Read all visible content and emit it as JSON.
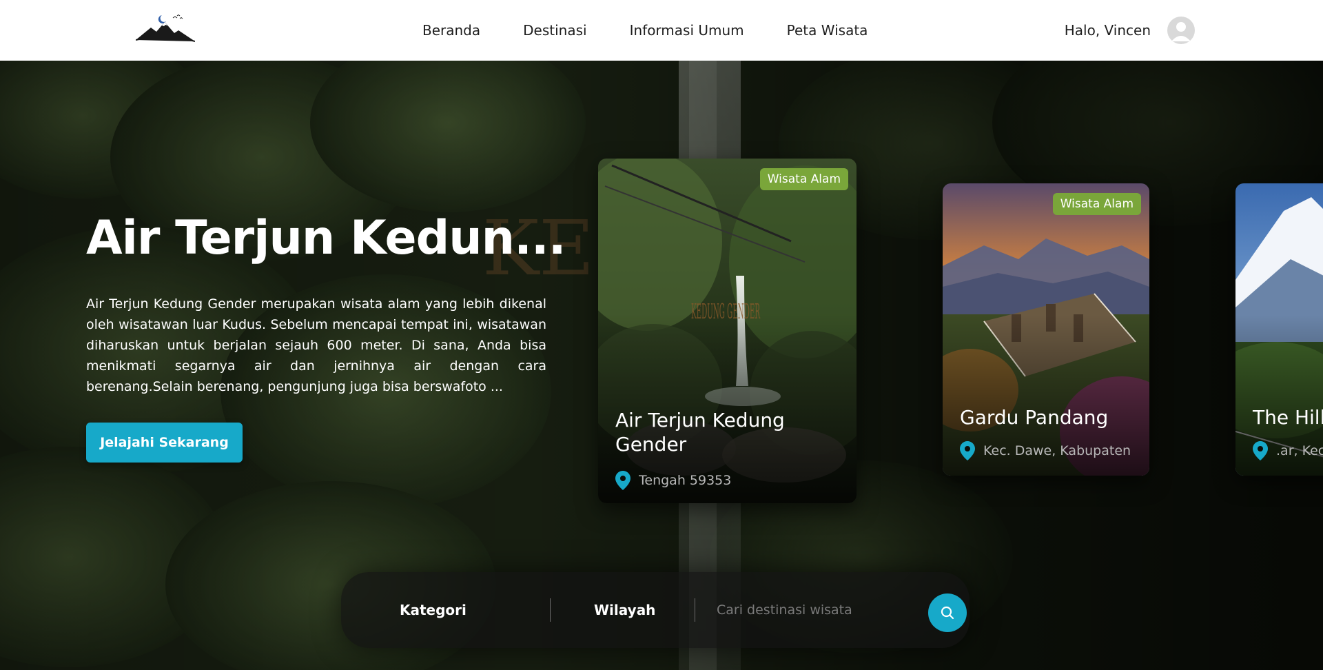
{
  "colors": {
    "accent": "#17a9c9",
    "badge": "#7aa63a",
    "nav_background": "#ffffff",
    "nav_text": "#1e1e1e"
  },
  "navbar": {
    "logo_icon": "mountain-moon-logo",
    "links": [
      "Beranda",
      "Destinasi",
      "Informasi Umum",
      "Peta Wisata"
    ],
    "greeting": "Halo, Vincen",
    "avatar_icon": "user-avatar-icon"
  },
  "hero": {
    "title": "Air Terjun Kedun...",
    "description": "Air Terjun Kedung Gender merupakan wisata alam yang lebih dikenal oleh wisatawan luar Kudus. Sebelum mencapai tempat ini, wisatawan diharuskan untuk berjalan sejauh 600 meter. Di sana, Anda bisa menikmati segarnya air dan jernihnya air dengan cara berenang.Selain berenang, pengunjung juga bisa berswafoto ...",
    "cta_label": "Jelajahi Sekarang"
  },
  "cards": [
    {
      "badge": "Wisata Alam",
      "title": "Air Terjun Kedung Gender",
      "location": "Tengah 59353",
      "image_text": "KEDUNG GENDER",
      "icon": "location-pin-icon"
    },
    {
      "badge": "Wisata Alam",
      "title": "Gardu Pandang",
      "location": "Kec. Dawe, Kabupaten",
      "icon": "location-pin-icon"
    },
    {
      "badge": "",
      "title": "The Hills",
      "location": "ar, Kec.",
      "icon": "location-pin-icon"
    }
  ],
  "search": {
    "category_label": "Kategori",
    "region_label": "Wilayah",
    "placeholder": "Cari destinasi wisata",
    "button_icon": "search-icon"
  }
}
